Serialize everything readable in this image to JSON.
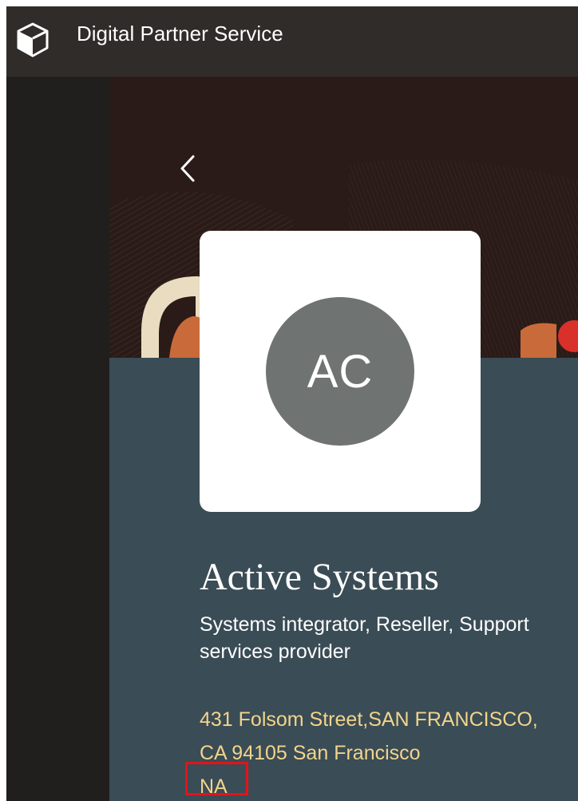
{
  "header": {
    "app_title": "Digital Partner Service",
    "icon": "cube-icon"
  },
  "navigation": {
    "back_icon": "chevron-left-icon"
  },
  "profile": {
    "initials": "AC",
    "company_name": "Active Systems",
    "company_type": "Systems integrator, Reseller, Support services provider",
    "address_line_1": "431 Folsom Street,SAN FRANCISCO,",
    "address_line_2": "CA 94105 San Francisco",
    "region": "NA"
  },
  "colors": {
    "header_bg": "#302c29",
    "panel_bg": "#3a4c55",
    "address_text": "#f2d48c",
    "avatar_bg": "#6f7372",
    "highlight": "#e1141b"
  }
}
